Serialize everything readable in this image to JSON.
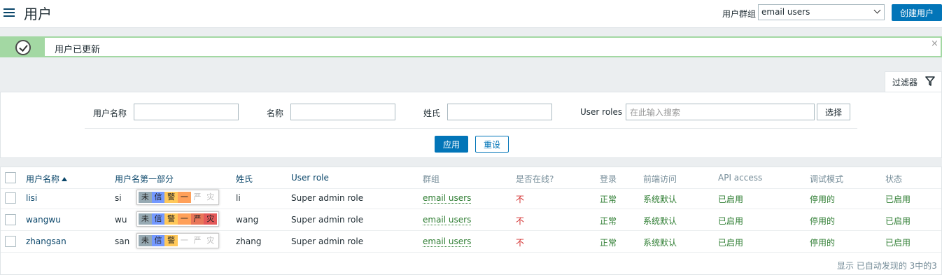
{
  "header": {
    "title": "用户",
    "group_label": "用户群组",
    "group_selected": "email users",
    "create_button": "创建用户"
  },
  "message": {
    "text": "用户已更新",
    "close": "×"
  },
  "filter": {
    "tab_label": "过滤器",
    "username_label": "用户名称",
    "name_label": "名称",
    "surname_label": "姓氏",
    "roles_label": "User roles",
    "roles_placeholder": "在此输入搜索",
    "choose_button": "选择",
    "apply_button": "应用",
    "reset_button": "重设"
  },
  "table": {
    "headers": {
      "username": "用户名称",
      "first_part": "用户名第一部分",
      "surname": "姓氏",
      "user_role": "User role",
      "groups": "群组",
      "online": "是否在线?",
      "login": "登录",
      "frontend": "前端访问",
      "api": "API access",
      "debug": "调试模式",
      "status": "状态"
    },
    "rows": [
      {
        "username": "lisi",
        "first_part": "si",
        "surname": "li",
        "role": "Super admin role",
        "group": "email users",
        "online": "不",
        "login": "正常",
        "frontend": "系统默认",
        "api": "已启用",
        "debug": "停用的",
        "status": "已启用",
        "severity": [
          {
            "label": "未",
            "color": "#97aab3"
          },
          {
            "label": "信",
            "color": "#7499ff"
          },
          {
            "label": "警",
            "color": "#ffc859"
          },
          {
            "label": "一",
            "color": "#ffa059"
          },
          {
            "label": "严",
            "color": "#ffffff"
          },
          {
            "label": "灾",
            "color": "#ffffff"
          }
        ]
      },
      {
        "username": "wangwu",
        "first_part": "wu",
        "surname": "wang",
        "role": "Super admin role",
        "group": "email users",
        "online": "不",
        "login": "正常",
        "frontend": "系统默认",
        "api": "已启用",
        "debug": "停用的",
        "status": "已启用",
        "severity": [
          {
            "label": "未",
            "color": "#97aab3"
          },
          {
            "label": "信",
            "color": "#7499ff"
          },
          {
            "label": "警",
            "color": "#ffc859"
          },
          {
            "label": "一",
            "color": "#ffa059"
          },
          {
            "label": "严",
            "color": "#e97659"
          },
          {
            "label": "灾",
            "color": "#e45959"
          }
        ]
      },
      {
        "username": "zhangsan",
        "first_part": "san",
        "surname": "zhang",
        "role": "Super admin role",
        "group": "email users",
        "online": "不",
        "login": "正常",
        "frontend": "系统默认",
        "api": "已启用",
        "debug": "停用的",
        "status": "已启用",
        "severity": [
          {
            "label": "未",
            "color": "#97aab3"
          },
          {
            "label": "信",
            "color": "#7499ff"
          },
          {
            "label": "警",
            "color": "#ffc859"
          },
          {
            "label": "一",
            "color": "#ffffff"
          },
          {
            "label": "严",
            "color": "#ffffff"
          },
          {
            "label": "灾",
            "color": "#ffffff"
          }
        ]
      }
    ],
    "footer": "显示 已自动发现的 3中的3"
  }
}
